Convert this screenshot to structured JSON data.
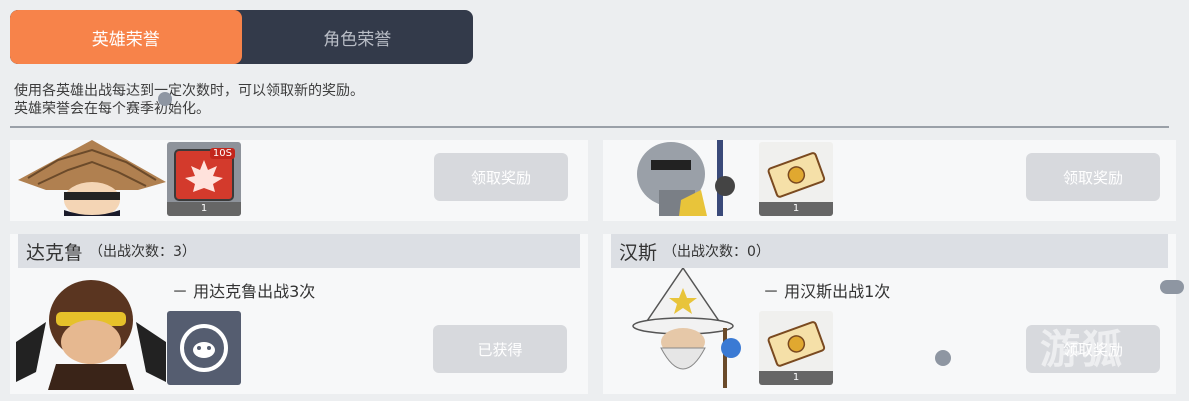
{
  "tabs": {
    "active_label": "英雄荣誉",
    "inactive_label": "角色荣誉"
  },
  "description": {
    "line1": "使用各英雄出战每达到一定次数时，可以领取新的奖励。",
    "line2": "英雄荣誉会在每个赛季初始化。"
  },
  "top_cards": [
    {
      "reward_qty": "1",
      "reward_badge": "10S",
      "button_label": "领取奖励"
    },
    {
      "reward_qty": "1",
      "button_label": "领取奖励"
    }
  ],
  "hero_cards": [
    {
      "name": "达克鲁",
      "count_text": "（出战次数：3）",
      "condition": "－ 用达克鲁出战3次",
      "button_label": "已获得",
      "reward_qty": ""
    },
    {
      "name": "汉斯",
      "count_text": "（出战次数：0）",
      "condition": "－ 用汉斯出战1次",
      "button_label": "领取奖励",
      "reward_qty": "1"
    }
  ],
  "watermark_text": "游狐",
  "colors": {
    "accent": "#f7834a",
    "tabbar_bg": "#333a4a",
    "button_disabled": "#d7d9dd",
    "card_header": "#dcdfe4"
  },
  "icons": [
    "maple-leaf-icon",
    "ticket-icon",
    "pet-face-icon"
  ]
}
